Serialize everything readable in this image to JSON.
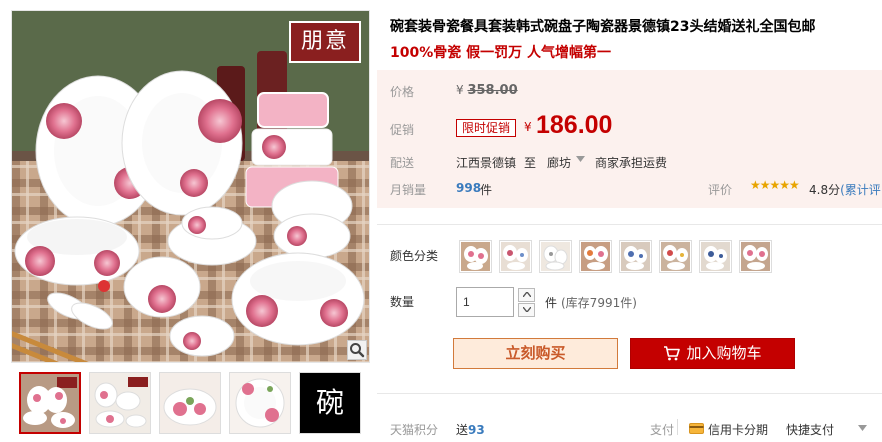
{
  "gallery": {
    "brand_badge": "朋意",
    "thumb_text": "碗"
  },
  "product": {
    "title": "碗套装骨瓷餐具套装韩式碗盘子陶瓷器景德镇23头结婚送礼全国包邮",
    "subtitle": "100%骨瓷 假一罚万 人气增幅第一"
  },
  "price": {
    "label": "价格",
    "currency": "¥",
    "original": "358.00"
  },
  "promo": {
    "label": "促销",
    "tag": "限时促销",
    "currency": "¥",
    "price": "186.00"
  },
  "shipping": {
    "label": "配送",
    "origin": "江西景德镇",
    "to_word": "至",
    "destination": "廊坊",
    "fee": "商家承担运费"
  },
  "sales": {
    "label": "月销量",
    "count": "998",
    "unit": "件"
  },
  "rating": {
    "label": "评价",
    "stars": "★★★★★",
    "score": "4.8分",
    "link": "(累计评"
  },
  "color": {
    "label": "颜色分类"
  },
  "quantity": {
    "label": "数量",
    "value": "1",
    "unit": "件",
    "stock": "(库存7991件)"
  },
  "actions": {
    "buy_now": "立刻购买",
    "add_to_cart": "加入购物车"
  },
  "points": {
    "label": "天猫积分",
    "prefix": "送",
    "value": "93"
  },
  "payment": {
    "label": "支付",
    "credit": "信用卡分期",
    "quick": "快捷支付"
  },
  "colors": {
    "accent_red": "#c40000",
    "link_blue": "#3a7bbd",
    "price_panel_bg": "#fcf1ee",
    "buy_now_bg": "#feebdb"
  }
}
